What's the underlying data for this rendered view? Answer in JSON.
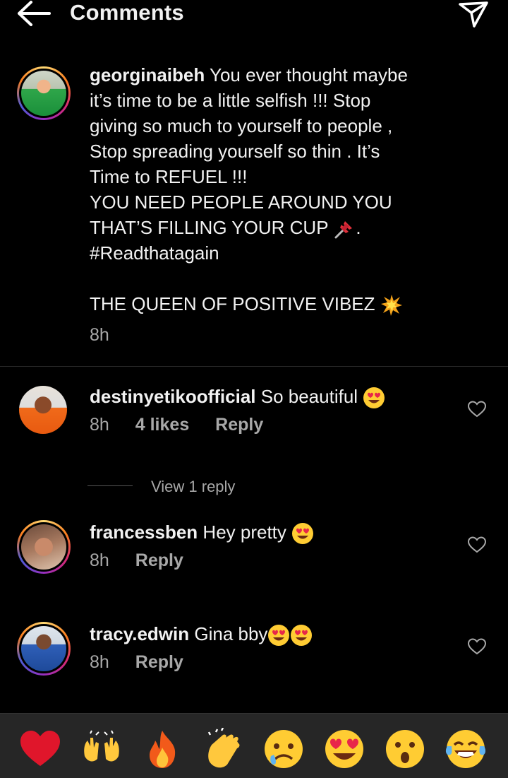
{
  "header": {
    "title": "Comments"
  },
  "caption": {
    "username": "georginaibeh",
    "lines": [
      "You ever thought maybe",
      "it’s time to be a little selfish !!! Stop",
      "giving so much to yourself to people ,",
      "Stop spreading yourself so thin . It’s",
      "Time to REFUEL !!!",
      "YOU NEED PEOPLE AROUND YOU",
      "THAT’S FILLING YOUR CUP",
      "#Readthatagain",
      "THE QUEEN OF POSITIVE VIBEZ"
    ],
    "line7_suffix": ".",
    "time": "8h"
  },
  "comments": [
    {
      "username": "destinyetikoofficial",
      "text": "So beautiful",
      "time": "8h",
      "likes": "4 likes",
      "reply": "Reply"
    },
    {
      "username": "francessben",
      "text": "Hey pretty",
      "time": "8h",
      "reply": "Reply"
    },
    {
      "username": "tracy.edwin",
      "text": "Gina bby",
      "time": "8h",
      "reply": "Reply"
    }
  ],
  "view_replies": "View 1 reply",
  "emoji_bar": [
    "red-heart",
    "raising-hands",
    "fire",
    "clapping-hands",
    "sad-face",
    "heart-eyes-face",
    "surprised-face",
    "tears-of-joy-face"
  ]
}
